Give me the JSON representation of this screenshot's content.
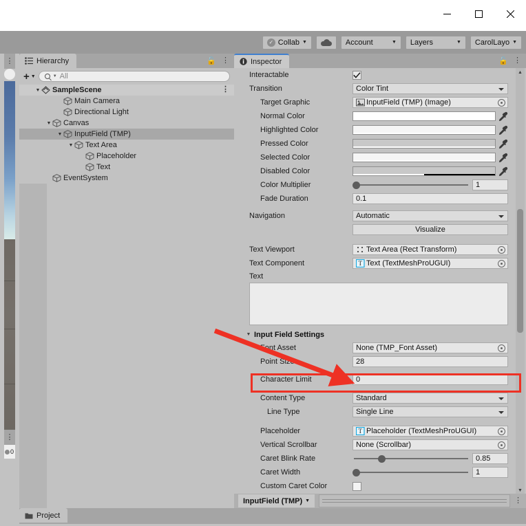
{
  "window": {
    "controls": [
      {
        "name": "minimize",
        "glyph": "minimize-icon"
      },
      {
        "name": "maximize",
        "glyph": "maximize-icon"
      },
      {
        "name": "close",
        "glyph": "close-icon"
      }
    ]
  },
  "toolbar": {
    "collab_label": "Collab",
    "cloud_label": "cloud-icon",
    "account_label": "Account",
    "layers_label": "Layers",
    "layout_label": "CarolLayo"
  },
  "hierarchy": {
    "tab_label": "Hierarchy",
    "create_label": "+",
    "search_placeholder": "All",
    "search_value": "",
    "tree": [
      {
        "label": "SampleScene",
        "depth": 0,
        "icon": "scene-icon",
        "expanded": true,
        "selected": false,
        "scene": true
      },
      {
        "label": "Main Camera",
        "depth": 2,
        "icon": "gameobject-icon",
        "expanded": null,
        "selected": false
      },
      {
        "label": "Directional Light",
        "depth": 2,
        "icon": "gameobject-icon",
        "expanded": null,
        "selected": false
      },
      {
        "label": "Canvas",
        "depth": 1,
        "icon": "gameobject-icon",
        "expanded": true,
        "selected": false
      },
      {
        "label": "InputField (TMP)",
        "depth": 2,
        "icon": "gameobject-icon",
        "expanded": true,
        "selected": true
      },
      {
        "label": "Text Area",
        "depth": 3,
        "icon": "gameobject-icon",
        "expanded": true,
        "selected": false
      },
      {
        "label": "Placeholder",
        "depth": 4,
        "icon": "gameobject-icon",
        "expanded": null,
        "selected": false
      },
      {
        "label": "Text",
        "depth": 4,
        "icon": "gameobject-icon",
        "expanded": null,
        "selected": false
      },
      {
        "label": "EventSystem",
        "depth": 1,
        "icon": "gameobject-icon",
        "expanded": null,
        "selected": false
      }
    ]
  },
  "inspector": {
    "tab_label": "Inspector",
    "rows": {
      "interactable": {
        "label": "Interactable",
        "checked": true
      },
      "transition": {
        "label": "Transition",
        "value": "Color Tint"
      },
      "target_graphic": {
        "label": "Target Graphic",
        "value": "InputField (TMP) (Image)"
      },
      "normal_color": {
        "label": "Normal Color",
        "color": "#ffffff",
        "alpha": 100
      },
      "highlighted_color": {
        "label": "Highlighted Color",
        "color": "#f5f5f5",
        "alpha": 100
      },
      "pressed_color": {
        "label": "Pressed Color",
        "color": "#c8c8c8",
        "alpha": 100
      },
      "selected_color": {
        "label": "Selected Color",
        "color": "#f5f5f5",
        "alpha": 100
      },
      "disabled_color": {
        "label": "Disabled Color",
        "color": "#c8c8c8",
        "alpha": 50
      },
      "color_multiplier": {
        "label": "Color Multiplier",
        "value": "1",
        "slider_pct": 0
      },
      "fade_duration": {
        "label": "Fade Duration",
        "value": "0.1"
      },
      "navigation": {
        "label": "Navigation",
        "value": "Automatic"
      },
      "visualize": {
        "label": "Visualize"
      },
      "text_viewport": {
        "label": "Text Viewport",
        "value": "Text Area (Rect Transform)"
      },
      "text_component": {
        "label": "Text Component",
        "value": "Text (TextMeshProUGUI)"
      },
      "text": {
        "label": "Text",
        "value": ""
      }
    },
    "input_field_settings": {
      "title": "Input Field Settings",
      "font_asset": {
        "label": "Font Asset",
        "value": "None (TMP_Font Asset)"
      },
      "point_size": {
        "label": "Point Size",
        "value": "28"
      },
      "character_limit": {
        "label": "Character Limit",
        "value": "0"
      },
      "content_type": {
        "label": "Content Type",
        "value": "Standard"
      },
      "line_type": {
        "label": "Line Type",
        "value": "Single Line"
      },
      "placeholder": {
        "label": "Placeholder",
        "value": "Placeholder (TextMeshProUGUI)"
      },
      "vertical_scrollbar": {
        "label": "Vertical Scrollbar",
        "value": "None (Scrollbar)"
      },
      "caret_blink_rate": {
        "label": "Caret Blink Rate",
        "value": "0.85",
        "slider_pct": 22
      },
      "caret_width": {
        "label": "Caret Width",
        "value": "1",
        "slider_pct": 0
      },
      "custom_caret_color": {
        "label": "Custom Caret Color",
        "checked": false
      }
    },
    "footer_tab": "InputField (TMP)"
  },
  "project": {
    "tab_label": "Project"
  },
  "console": {
    "count": "0"
  },
  "annotation": {
    "highlight_color": "#ee3124",
    "target": "Character Limit"
  }
}
